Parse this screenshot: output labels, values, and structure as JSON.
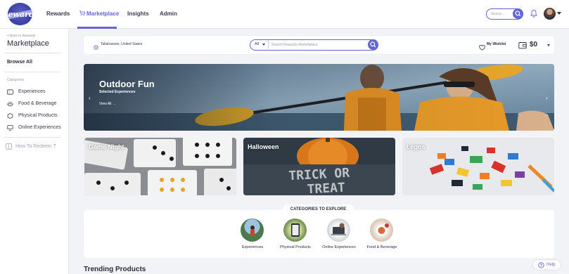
{
  "topnav": {
    "logo_text": "Rewards",
    "links": [
      {
        "label": "Rewards"
      },
      {
        "label": "Marketplace"
      },
      {
        "label": "Insights"
      },
      {
        "label": "Admin"
      }
    ],
    "search_placeholder": "Click to...",
    "accent": "#6266d6"
  },
  "sidebar": {
    "back_label": "< Back to Rewards",
    "title": "Marketplace",
    "browse_all": "Browse All",
    "categories_label": "Categories",
    "categories": [
      {
        "label": "Experiences",
        "icon": "ticket-icon"
      },
      {
        "label": "Food & Beverage",
        "icon": "food-icon"
      },
      {
        "label": "Physical Products",
        "icon": "box-icon"
      },
      {
        "label": "Online Experiences",
        "icon": "monitor-icon"
      }
    ],
    "redeem_label": "How To Redeem ?"
  },
  "searchbar": {
    "location": "Tallahassee, United States",
    "scope": "All",
    "placeholder": "Search Rewards Marketplace",
    "wishlist": "My Wishlist",
    "balance": "$0"
  },
  "hero": {
    "title": "Outdoor Fun",
    "subtitle": "Selected Experiences",
    "view_all": "View All →"
  },
  "tiles": [
    {
      "label": "Game Night"
    },
    {
      "label": "Halloween"
    },
    {
      "label": "Legos"
    }
  ],
  "explore": {
    "heading": "CATEGORIES TO EXPLORE",
    "items": [
      {
        "label": "Experiences"
      },
      {
        "label": "Physical Products"
      },
      {
        "label": "Online Experiences"
      },
      {
        "label": "Food & Beverage"
      }
    ]
  },
  "trending_title": "Trending Products",
  "help_label": "Help"
}
